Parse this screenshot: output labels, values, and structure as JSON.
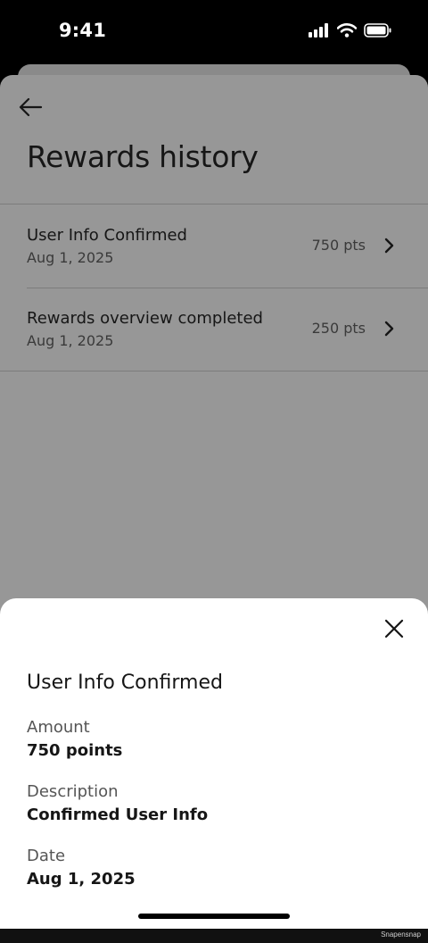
{
  "status_bar": {
    "time": "9:41",
    "icons": [
      "cellular-signal-icon",
      "wifi-icon",
      "battery-icon"
    ]
  },
  "header": {
    "back_icon": "arrow-left-icon",
    "title": "Rewards history"
  },
  "history": [
    {
      "title": "User Info Confirmed",
      "date": "Aug 1, 2025",
      "points": "750 pts"
    },
    {
      "title": "Rewards overview completed",
      "date": "Aug 1, 2025",
      "points": "250 pts"
    }
  ],
  "sheet": {
    "close_icon": "close-icon",
    "title": "User Info Confirmed",
    "amount_label": "Amount",
    "amount_value": "750 points",
    "description_label": "Description",
    "description_value": "Confirmed User Info",
    "date_label": "Date",
    "date_value": "Aug 1, 2025"
  },
  "watermark": "Snapensnap",
  "colors": {
    "overlay": "#979797",
    "sheet": "#ffffff",
    "text": "#161616"
  }
}
